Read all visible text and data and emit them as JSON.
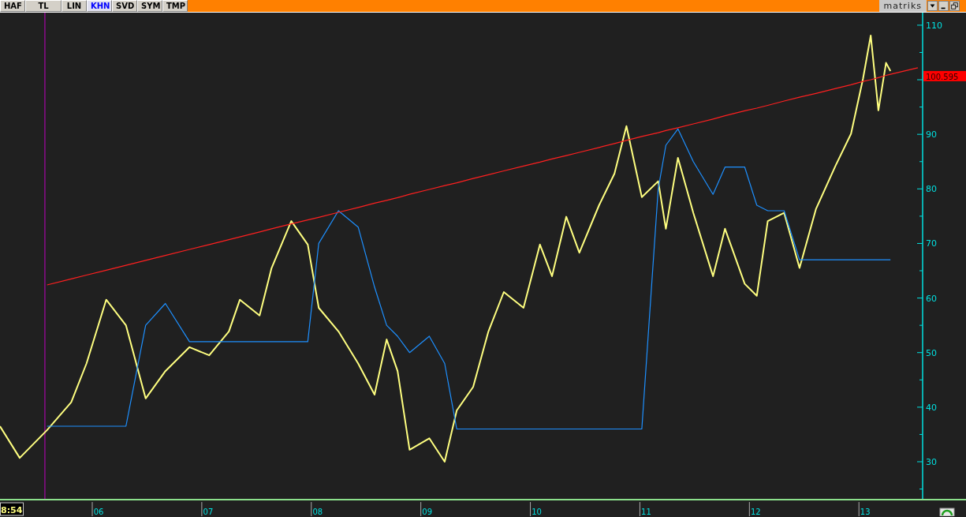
{
  "toolbar": {
    "buttons": [
      {
        "label": "HAF",
        "selected": false
      },
      {
        "label": "TL",
        "selected": false
      },
      {
        "label": "LIN",
        "selected": false
      },
      {
        "label": "KHN",
        "selected": true
      },
      {
        "label": "SVD",
        "selected": false
      },
      {
        "label": "SYM",
        "selected": false
      },
      {
        "label": "TMP",
        "selected": false
      }
    ],
    "logo": "matriks"
  },
  "chart": {
    "last_price": "100.595",
    "clock": "8:54",
    "chart_data": {
      "type": "line",
      "xlim": [
        5.1,
        13.92
      ],
      "ylim": [
        23.2,
        112.3
      ],
      "yticks": [
        {
          "value": 30,
          "label": "30"
        },
        {
          "value": 40,
          "label": "40"
        },
        {
          "value": 50,
          "label": "50"
        },
        {
          "value": 60,
          "label": "60"
        },
        {
          "value": 70,
          "label": "70"
        },
        {
          "value": 80,
          "label": "80"
        },
        {
          "value": 90,
          "label": "90"
        },
        {
          "value": 110,
          "label": "110"
        }
      ],
      "xticks": [
        {
          "value": 6,
          "label": "06"
        },
        {
          "value": 7,
          "label": "07"
        },
        {
          "value": 8,
          "label": "08"
        },
        {
          "value": 9,
          "label": "09"
        },
        {
          "value": 10,
          "label": "10"
        },
        {
          "value": 11,
          "label": "11"
        },
        {
          "value": 12,
          "label": "12"
        },
        {
          "value": 13,
          "label": "13"
        }
      ],
      "x": [
        5.1,
        5.28,
        5.53,
        5.75,
        5.89,
        6.07,
        6.25,
        6.43,
        6.61,
        6.83,
        7.01,
        7.19,
        7.29,
        7.47,
        7.58,
        7.76,
        7.91,
        8.01,
        8.19,
        8.37,
        8.52,
        8.63,
        8.73,
        8.84,
        9.02,
        9.16,
        9.27,
        9.42,
        9.56,
        9.7,
        9.88,
        10.03,
        10.14,
        10.27,
        10.39,
        10.57,
        10.71,
        10.82,
        10.96,
        11.11,
        11.18,
        11.29,
        11.43,
        11.61,
        11.72,
        11.9,
        12.01,
        12.11,
        12.26,
        12.4,
        12.55,
        12.73,
        12.87,
        12.98,
        13.05,
        13.12,
        13.19,
        13.23,
        13.48
      ],
      "series": [
        {
          "color": "#ffff80",
          "values": [
            36.5,
            30.7,
            35.8,
            40.9,
            48,
            59.7,
            55,
            41.6,
            46.6,
            51,
            49.5,
            53.9,
            59.7,
            56.8,
            65.5,
            74.1,
            69.8,
            58.2,
            53.9,
            48,
            42.3,
            52.4,
            46.6,
            32.2,
            34.3,
            30,
            39.4,
            43.7,
            53.9,
            61.1,
            58.2,
            69.8,
            64,
            74.9,
            68.3,
            77,
            82.8,
            91.5,
            78.5,
            81.4,
            72.7,
            85.7,
            75.6,
            64,
            72.7,
            62.6,
            60.4,
            74.1,
            75.6,
            65.5,
            76.3,
            84.3,
            90.1,
            100.2,
            108.1,
            94.4,
            103.1,
            101.6,
            null
          ]
        },
        {
          "color": "#1e90ff",
          "values": [
            null,
            null,
            36.5,
            36.5,
            36.5,
            36.5,
            36.5,
            55,
            59,
            52,
            52,
            52,
            52,
            52,
            52,
            52,
            52,
            70,
            76,
            73,
            62,
            55,
            53,
            50,
            53,
            48,
            36,
            36,
            36,
            36,
            36,
            36,
            36,
            36,
            36,
            36,
            36,
            36,
            36,
            80,
            88,
            91,
            85,
            79,
            84,
            84,
            77,
            76,
            76,
            67,
            67,
            67,
            67,
            67,
            67,
            67,
            67,
            67,
            null
          ]
        },
        {
          "color": "#ff2020",
          "values": [
            null,
            null,
            62.4,
            63.5,
            64.2,
            65.1,
            66,
            66.9,
            67.8,
            68.9,
            69.8,
            70.7,
            71.2,
            72.1,
            72.7,
            73.6,
            74.3,
            74.8,
            75.7,
            76.6,
            77.4,
            77.9,
            78.4,
            79,
            79.9,
            80.6,
            81.1,
            81.9,
            82.6,
            83.3,
            84.2,
            84.9,
            85.5,
            86.1,
            86.7,
            87.6,
            88.3,
            88.9,
            89.6,
            90.3,
            90.7,
            91.2,
            91.9,
            92.8,
            93.4,
            94.3,
            94.8,
            95.3,
            96.1,
            96.8,
            97.5,
            98.4,
            99.1,
            99.7,
            100,
            100.4,
            100.8,
            101,
            102.2
          ]
        }
      ],
      "ref_lines": [
        {
          "axis": "x",
          "value": 5.51,
          "color": "#c000c0"
        }
      ]
    }
  }
}
